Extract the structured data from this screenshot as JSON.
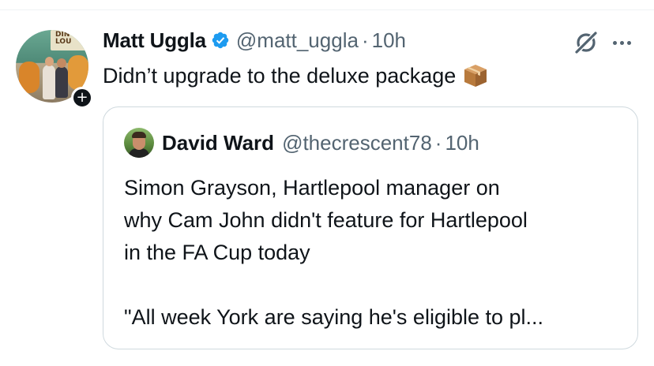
{
  "tweet": {
    "author_name": "Matt Uggla",
    "author_handle": "@matt_uggla",
    "separator": "·",
    "time": "10h",
    "text": "Didn’t upgrade to the deluxe package",
    "avatar_sign_text": "DIN\nLOU",
    "follow_glyph": "+",
    "icons": {
      "verified": "verified-badge-icon",
      "grok": "grok-icon",
      "more": "more-options-icon",
      "package": "package-emoji-icon"
    }
  },
  "quote": {
    "author_name": "David Ward",
    "author_handle": "@thecrescent78",
    "separator": "·",
    "time": "10h",
    "lines": [
      "Simon Grayson, Hartlepool manager on",
      "why Cam John didn't feature for Hartlepool",
      "in the FA Cup today",
      "",
      "\"All week York are saying he's eligible to pl..."
    ]
  },
  "colors": {
    "primary_text": "#0f1419",
    "secondary_text": "#536471",
    "verified_blue": "#1d9bf0",
    "border": "#cfd9de"
  }
}
